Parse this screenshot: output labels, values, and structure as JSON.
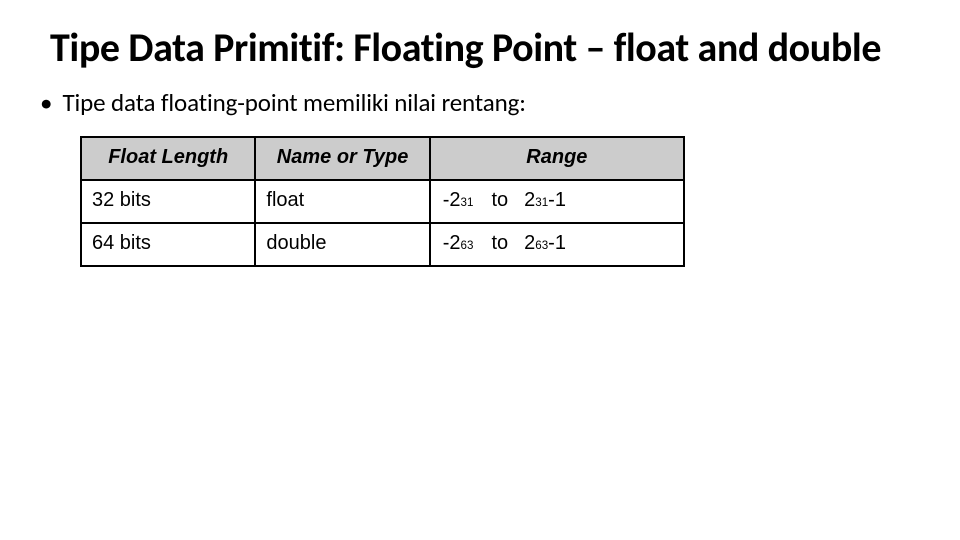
{
  "title": "Tipe Data Primitif: Floating Point – float and double",
  "bullet": "Tipe data floating-point memiliki nilai rentang:",
  "table": {
    "headers": {
      "length": "Float Length",
      "name": "Name or Type",
      "range": "Range"
    },
    "rows": [
      {
        "length": "32 bits",
        "name": "float",
        "range_low_base": "-2",
        "range_low_exp": "31",
        "range_to": "to",
        "range_high_base": "2",
        "range_high_exp": "31",
        "range_high_tail": "-1"
      },
      {
        "length": "64 bits",
        "name": "double",
        "range_low_base": "-2",
        "range_low_exp": "63",
        "range_to": "to",
        "range_high_base": "2",
        "range_high_exp": "63",
        "range_high_tail": "-1"
      }
    ]
  }
}
